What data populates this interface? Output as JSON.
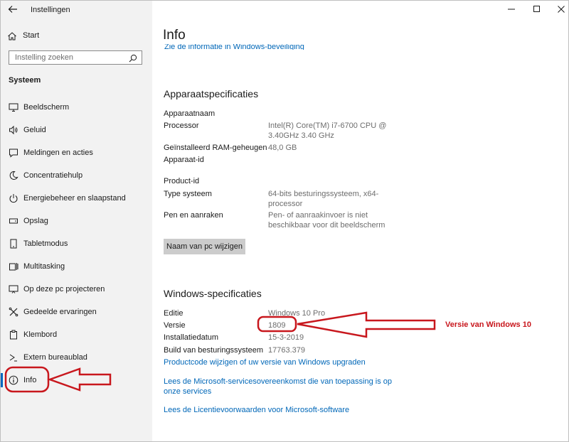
{
  "window": {
    "title": "Instellingen"
  },
  "sidebar": {
    "start_label": "Start",
    "search_placeholder": "Instelling zoeken",
    "section_title": "Systeem",
    "items": [
      {
        "label": "Beeldscherm",
        "icon": "monitor-icon"
      },
      {
        "label": "Geluid",
        "icon": "speaker-icon"
      },
      {
        "label": "Meldingen en acties",
        "icon": "notification-icon"
      },
      {
        "label": "Concentratiehulp",
        "icon": "moon-icon"
      },
      {
        "label": "Energiebeheer en slaapstand",
        "icon": "power-icon"
      },
      {
        "label": "Opslag",
        "icon": "storage-icon"
      },
      {
        "label": "Tabletmodus",
        "icon": "tablet-icon"
      },
      {
        "label": "Multitasking",
        "icon": "multitasking-icon"
      },
      {
        "label": "Op deze pc projecteren",
        "icon": "project-icon"
      },
      {
        "label": "Gedeelde ervaringen",
        "icon": "shared-experiences-icon"
      },
      {
        "label": "Klembord",
        "icon": "clipboard-icon"
      },
      {
        "label": "Extern bureaublad",
        "icon": "remote-desktop-icon"
      },
      {
        "label": "Info",
        "icon": "info-icon",
        "active": true
      }
    ]
  },
  "main": {
    "title": "Info",
    "security_link": "Zie de informatie in Windows-beveiliging",
    "device_specs": {
      "heading": "Apparaatspecificaties",
      "rows": [
        {
          "label": "Apparaatnaam",
          "value": ""
        },
        {
          "label": "Processor",
          "value": "Intel(R) Core(TM) i7-6700 CPU @",
          "value2": "3.40GHz   3.40 GHz"
        },
        {
          "label": "Geïnstalleerd RAM-geheugen",
          "value": "48,0 GB"
        },
        {
          "label": "Apparaat-id",
          "value": ""
        },
        {
          "label": "Product-id",
          "value": ""
        },
        {
          "label": "Type systeem",
          "value": "64-bits besturingssysteem, x64-",
          "value2": "processor"
        },
        {
          "label": "Pen en aanraken",
          "value": "Pen- of aanraakinvoer is niet",
          "value2": "beschikbaar voor dit beeldscherm"
        }
      ],
      "rename_button": "Naam van pc wijzigen"
    },
    "windows_specs": {
      "heading": "Windows-specificaties",
      "rows": [
        {
          "label": "Editie",
          "value": "Windows 10 Pro"
        },
        {
          "label": "Versie",
          "value": "1809"
        },
        {
          "label": "Installatiedatum",
          "value": "15-3-2019"
        },
        {
          "label": "Build van besturingssysteem",
          "value": "17763.379"
        }
      ],
      "links": [
        "Productcode wijzigen of uw versie van Windows upgraden",
        "Lees de Microsoft-servicesovereenkomst die van toepassing is op",
        "onze services",
        "Lees de Licentievoorwaarden voor Microsoft-software"
      ]
    }
  },
  "annotation": {
    "label": "Versie van Windows 10",
    "color": "#c8171d"
  },
  "colors": {
    "accent": "#0067c0",
    "link": "#0067b8",
    "sidebar_bg": "#f2f2f2"
  }
}
